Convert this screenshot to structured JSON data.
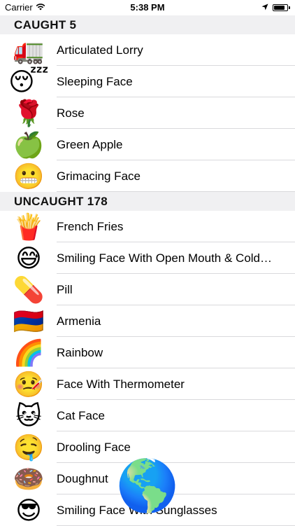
{
  "status_bar": {
    "carrier": "Carrier",
    "time": "5:38 PM",
    "battery_level": 0.85
  },
  "sections": [
    {
      "title": "CAUGHT 5",
      "items": [
        {
          "emoji": "🚛",
          "label": "Articulated Lorry"
        },
        {
          "emoji": "😴",
          "label": "Sleeping Face"
        },
        {
          "emoji": "🌹",
          "label": "Rose"
        },
        {
          "emoji": "🍏",
          "label": "Green Apple"
        },
        {
          "emoji": "😬",
          "label": "Grimacing Face"
        }
      ]
    },
    {
      "title": "UNCAUGHT 178",
      "items": [
        {
          "emoji": "🍟",
          "label": "French Fries"
        },
        {
          "emoji": "😅",
          "label": "Smiling Face With Open Mouth & Cold…"
        },
        {
          "emoji": "💊",
          "label": "Pill"
        },
        {
          "emoji": "🇦🇲",
          "label": "Armenia"
        },
        {
          "emoji": "🌈",
          "label": "Rainbow"
        },
        {
          "emoji": "🤒",
          "label": "Face With Thermometer"
        },
        {
          "emoji": "🐱",
          "label": "Cat Face"
        },
        {
          "emoji": "🤤",
          "label": "Drooling Face"
        },
        {
          "emoji": "🍩",
          "label": "Doughnut"
        },
        {
          "emoji": "😎",
          "label": "Smiling Face With Sunglasses"
        }
      ]
    }
  ],
  "floating_emoji": "🌎"
}
